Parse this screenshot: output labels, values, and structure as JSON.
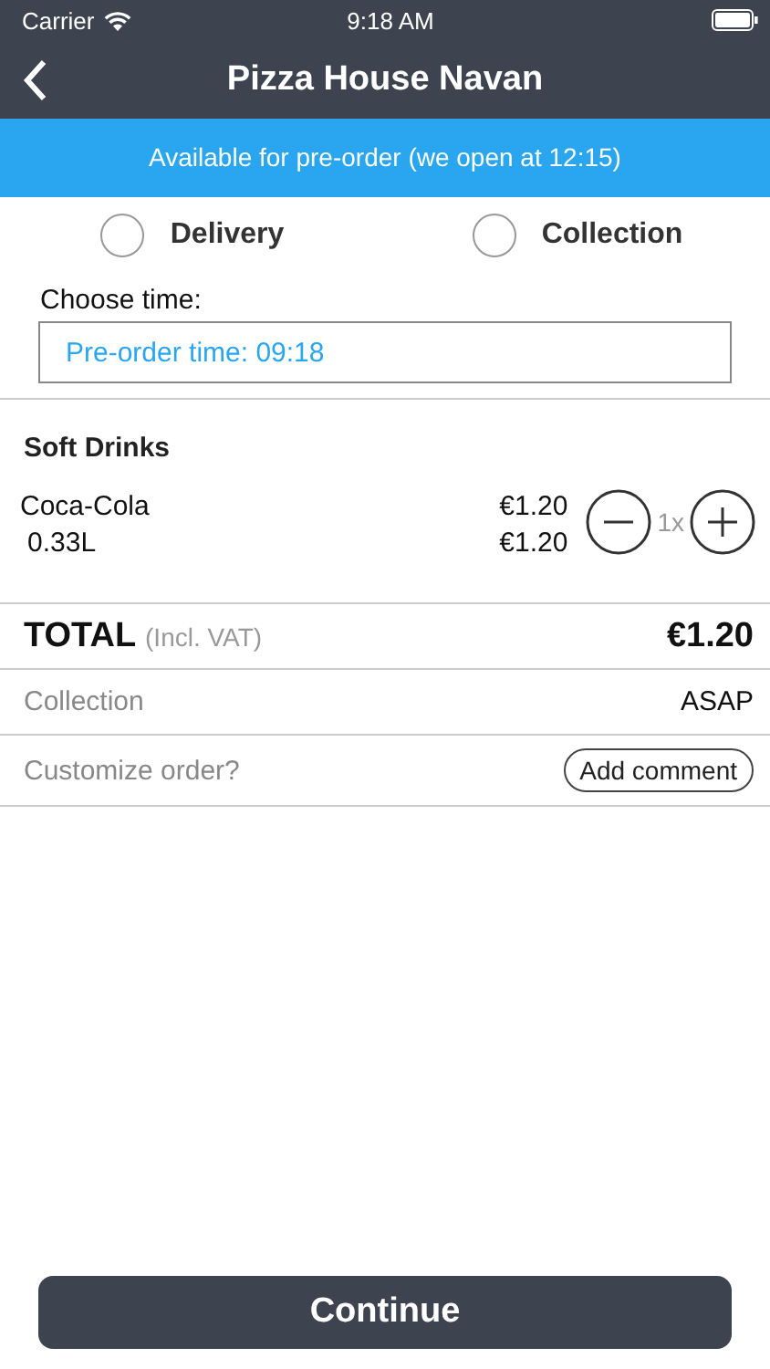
{
  "status_bar": {
    "carrier": "Carrier",
    "time": "9:18 AM"
  },
  "nav": {
    "title": "Pizza House Navan"
  },
  "banner": "Available for pre-order (we open at 12:15)",
  "order_types": [
    {
      "label": "Delivery",
      "selected": false
    },
    {
      "label": "Collection",
      "selected": false
    }
  ],
  "time_field": {
    "label": "Choose time:",
    "value": "Pre-order time: 09:18"
  },
  "category": "Soft Drinks",
  "items": [
    {
      "name": "Coca-Cola",
      "size": "0.33L",
      "price": "€1.20",
      "line_total": "€1.20",
      "quantity": "1x"
    }
  ],
  "total": {
    "label": "TOTAL",
    "note": "(Incl. VAT)",
    "amount": "€1.20"
  },
  "collection": {
    "label": "Collection",
    "value": "ASAP"
  },
  "customize": {
    "label": "Customize order?",
    "button": "Add comment"
  },
  "continue_button": "Continue"
}
